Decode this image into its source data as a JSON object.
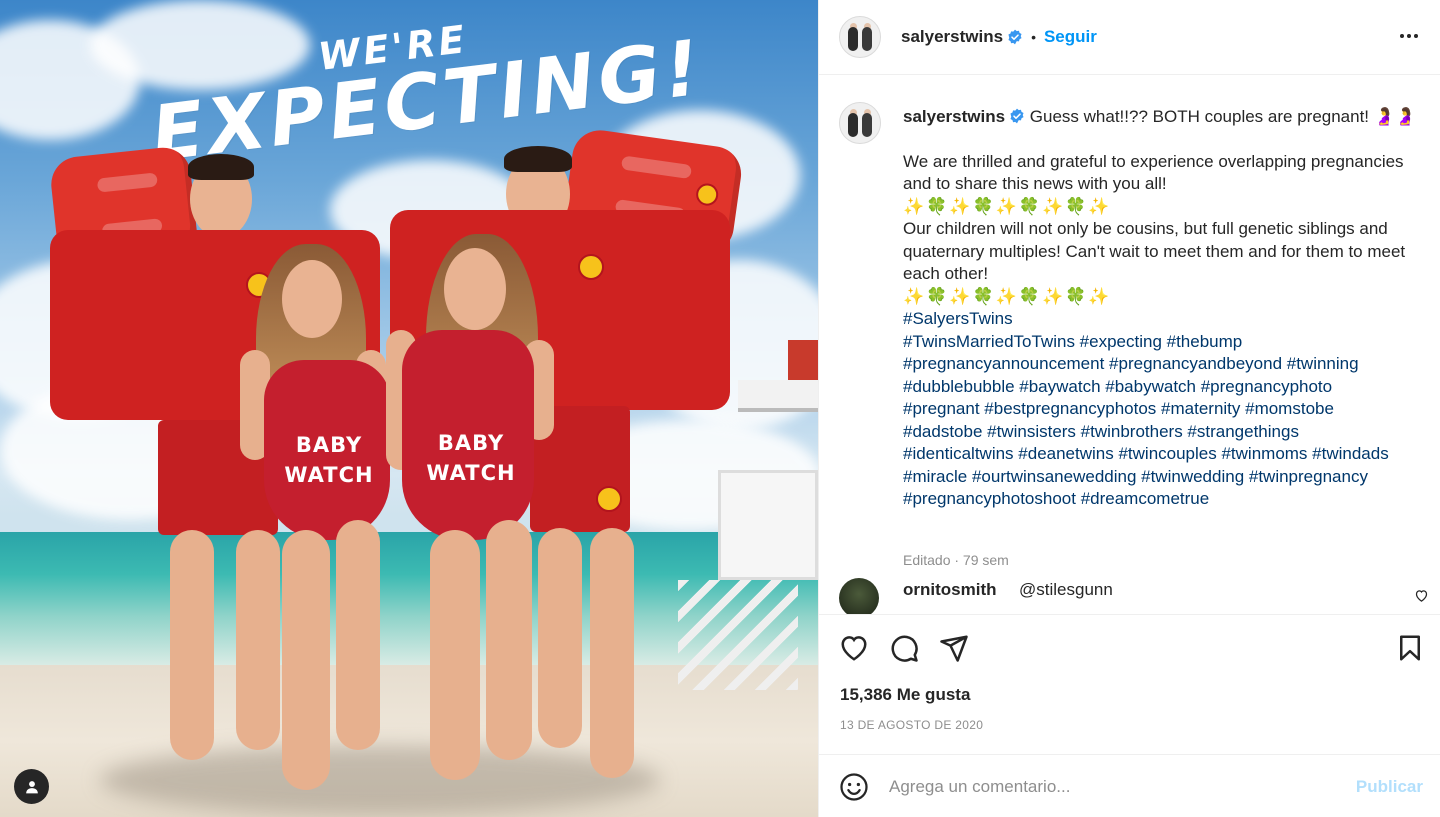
{
  "colors": {
    "accent": "#0095f6",
    "text": "#262626",
    "muted": "#8e8e8e",
    "hashtag": "#00376b",
    "publish_disabled": "#b2dffc",
    "verified": "#3897f0"
  },
  "photo": {
    "headline_small": "WE'RE",
    "headline_big": "EXPECTING!",
    "swimsuit_text_left": "BABY\nWATCH",
    "swimsuit_text_right": "BABY\nWATCH"
  },
  "header": {
    "username": "salyerstwins",
    "separator": "•",
    "follow_label": "Seguir",
    "more_icon": "more-horizontal-icon"
  },
  "caption": {
    "username": "salyerstwins",
    "first_line": "Guess what!!?? BOTH couples are pregnant! 🤰🤰",
    "para1": "We are thrilled and grateful to experience overlapping pregnancies and to share this news with you all!",
    "emoji_row_1": "✨🍀✨🍀✨🍀✨🍀✨",
    "para2": "Our children will not only be cousins, but full genetic siblings and quaternary multiples! Can't wait to meet them and for them to meet each other!",
    "emoji_row_2": "✨🍀✨🍀✨🍀✨🍀✨",
    "hashtags_1": "#SalyersTwins",
    "hashtags_2": "#TwinsMarriedToTwins #expecting #thebump",
    "hashtags_3": "#pregnancyannouncement #pregnancyandbeyond #twinning",
    "hashtags_4": "#dubblebubble #baywatch #babywatch #pregnancyphoto",
    "hashtags_5": "#pregnant #bestpregnancyphotos #maternity #momstobe",
    "hashtags_6": "#dadstobe #twinsisters #twinbrothers #strangethings",
    "hashtags_7": "#identicaltwins #deanetwins #twincouples #twinmoms #twindads",
    "hashtags_8": "#miracle #ourtwinsanewedding #twinwedding #twinpregnancy",
    "hashtags_9": "#pregnancyphotoshoot #dreamcometrue",
    "meta": "Editado · 79 sem"
  },
  "comment": {
    "username": "ornitosmith",
    "text": "@stilesgunn"
  },
  "actions": {
    "likes": "15,386 Me gusta",
    "date": "13 DE AGOSTO DE 2020"
  },
  "add_comment": {
    "placeholder": "Agrega un comentario...",
    "publish_label": "Publicar"
  }
}
